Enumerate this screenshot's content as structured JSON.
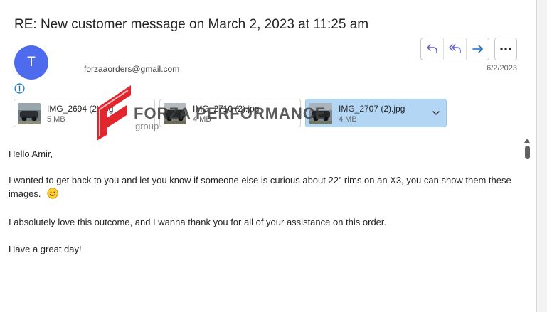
{
  "email": {
    "subject": "RE: New customer message on March 2, 2023 at 11:25 am",
    "avatar_initial": "T",
    "sender_email": "forzaaorders@gmail.com",
    "date": "6/2/2023"
  },
  "actions": {
    "reply_icon": "reply-icon",
    "reply_all_icon": "reply-all-icon",
    "forward_icon": "forward-icon",
    "more_icon": "more-icon"
  },
  "attachments": [
    {
      "name": "IMG_2694 (2).jpg",
      "size": "5 MB",
      "selected": false
    },
    {
      "name": "IMG_2710 (2).jpg",
      "size": "4 MB",
      "selected": false
    },
    {
      "name": "IMG_2707 (2).jpg",
      "size": "4 MB",
      "selected": true
    }
  ],
  "watermark": {
    "brand": "FORZA PERFORMANCE",
    "sub": "group"
  },
  "body": {
    "greeting": "Hello Amir,",
    "paragraph1": "I wanted to get back to you and let you know if someone else is curious about 22” rims on an X3, you can show them these images.",
    "paragraph2": "I absolutely love this outcome, and I wanna thank you for all of your assistance on this order.",
    "closing": "Have a great day!"
  },
  "colors": {
    "avatar": "#4f6bed",
    "accent": "#0f6cbd",
    "selected_attachment": "#b4d6f5",
    "watermark_red": "#e3262d"
  }
}
